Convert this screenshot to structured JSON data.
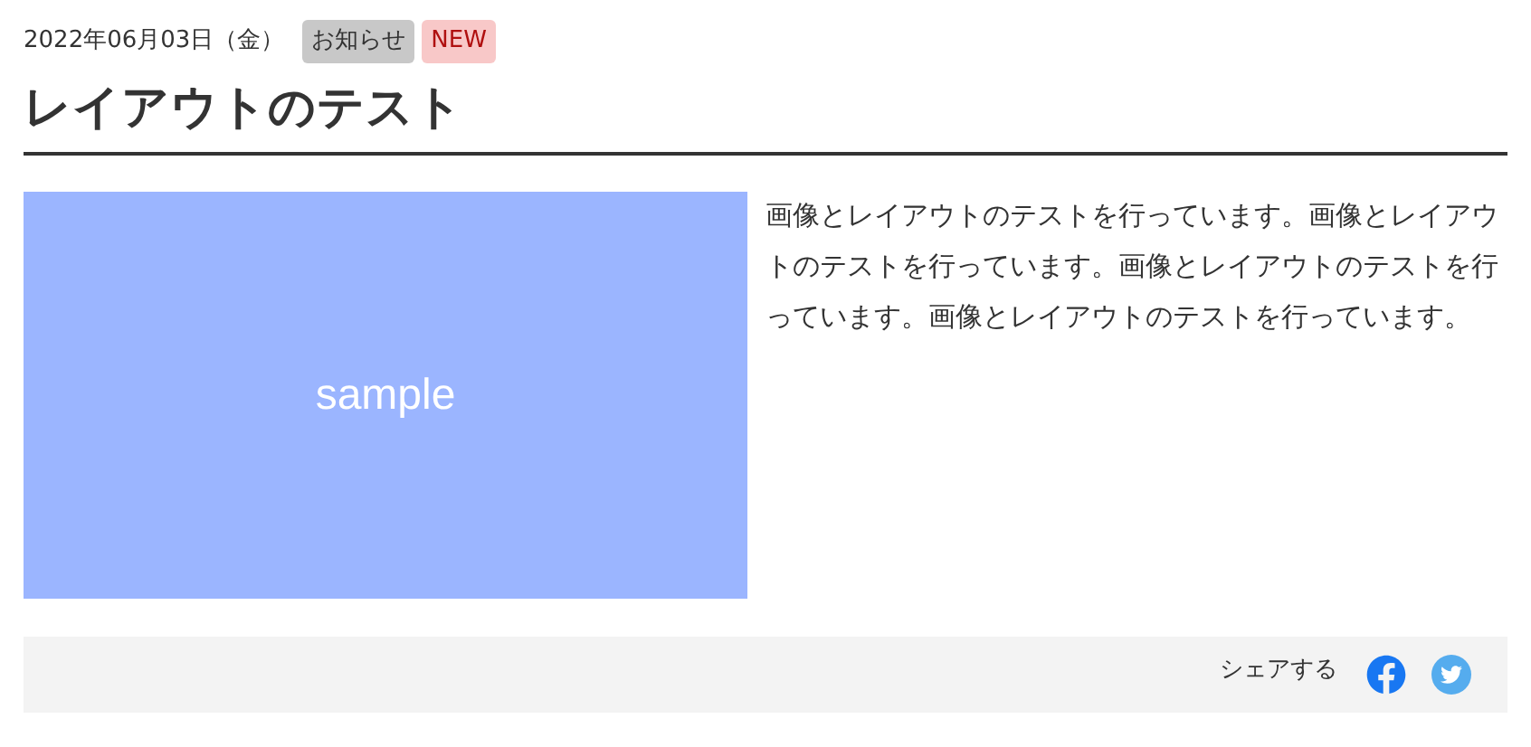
{
  "article": {
    "date": "2022年06月03日（金）",
    "tags": [
      {
        "label": "お知らせ",
        "kind": "category"
      },
      {
        "label": "NEW",
        "kind": "new"
      }
    ],
    "title": "レイアウトのテスト",
    "image": {
      "kind": "placeholder",
      "label": "sample"
    },
    "body": "画像とレイアウトのテストを行っています。画像とレイアウトのテストを行っています。画像とレイアウトのテストを行っています。画像とレイアウトのテストを行っています。"
  },
  "share_bar": {
    "label": "シェアする",
    "icons": [
      {
        "kind": "facebook"
      },
      {
        "kind": "twitter"
      }
    ]
  }
}
